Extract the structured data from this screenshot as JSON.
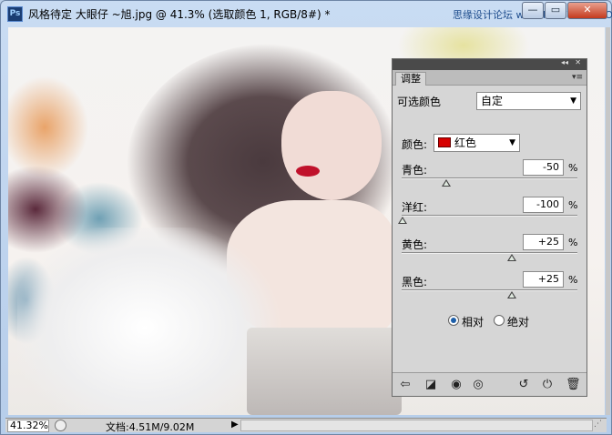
{
  "titlebar": {
    "app_icon_text": "Ps",
    "title": "风格待定 大眼仔 ~旭.jpg @ 41.3% (选取颜色 1, RGB/8#) *",
    "watermark": "思缘设计论坛 www.MISSYUAN.COM",
    "minimize": "—",
    "maximize": "▭",
    "close": "✕"
  },
  "panel": {
    "tab": "调整",
    "preset_label": "可选颜色",
    "preset_value": "自定",
    "color_label": "颜色:",
    "color_value": "红色",
    "color_swatch": "#d60000",
    "sliders": [
      {
        "label": "青色:",
        "value": "-50",
        "unit": "%"
      },
      {
        "label": "洋红:",
        "value": "-100",
        "unit": "%"
      },
      {
        "label": "黄色:",
        "value": "+25",
        "unit": "%"
      },
      {
        "label": "黑色:",
        "value": "+25",
        "unit": "%"
      }
    ],
    "mode_options": [
      {
        "label": "相对",
        "selected": true
      },
      {
        "label": "绝对",
        "selected": false
      }
    ],
    "footer_icons": [
      "back-arrow-icon",
      "clip-layer-icon",
      "visibility-eye-icon",
      "view-previous-icon",
      "reset-icon",
      "power-icon",
      "trash-icon"
    ]
  },
  "statusbar": {
    "zoom": "41.32%",
    "doc_info": "文档:4.51M/9.02M"
  }
}
